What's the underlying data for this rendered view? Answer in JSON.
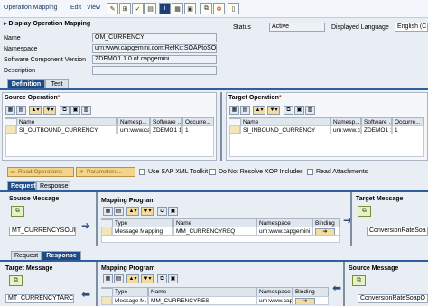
{
  "menu": {
    "operation_mapping": "Operation Mapping",
    "edit": "Edit",
    "view": "View"
  },
  "title": "Display Operation Mapping",
  "header": {
    "name_label": "Name",
    "name_value": "OM_CURRENCY",
    "namespace_label": "Namespace",
    "namespace_value": "urn:www.capgemini.com:RefKit:SOAPtoSOAP",
    "swc_label": "Software Component Version",
    "swc_value": "ZDEMO1 1.0 of capgemini",
    "description_label": "Description",
    "status_label": "Status",
    "status_value": "Active",
    "language_label": "Displayed Language",
    "language_value": "English (C"
  },
  "tabs": {
    "definition": "Definition",
    "test": "Test"
  },
  "source_operation": {
    "title": "Source Operation",
    "required_mark": "*",
    "columns": [
      "Name",
      "Namesp...",
      "Software ...",
      "Occurre..."
    ],
    "row": [
      "SI_OUTBOUND_CURRENCY",
      "urn:www.ca",
      "ZDEMO1 1.",
      "1"
    ]
  },
  "target_operation": {
    "title": "Target Operation",
    "required_mark": "*",
    "columns": [
      "Name",
      "Namesp...",
      "Software ...",
      "Occurre..."
    ],
    "row": [
      "SI_INBOUND_CURRENCY",
      "urn:www.ca",
      "ZDEMO1 1.",
      "1"
    ]
  },
  "actions": {
    "read_operations": "Read Operations",
    "parameters": "Parameters...",
    "use_sap_xml_toolkit": "Use SAP XML Toolkit",
    "do_not_resolve_xop": "Do Not Resolve XOP Includes",
    "read_attachments": "Read Attachments"
  },
  "request_tabs": {
    "request": "Request",
    "response": "Response"
  },
  "request": {
    "source_message_label": "Source Message",
    "source_message_value": "MT_CURRENCYSOUF",
    "mapping_program_label": "Mapping Program",
    "columns": [
      "Type",
      "Name",
      "Namespace",
      "Binding"
    ],
    "row": [
      "Message Mapping",
      "MM_CURRENCYREQ",
      "urn:www.capgemini",
      ""
    ],
    "target_message_label": "Target Message",
    "target_message_value": "ConversionRateSoa"
  },
  "response_tabs": {
    "request": "Request",
    "response": "Response"
  },
  "response": {
    "target_message_label": "Target Message",
    "target_message_value": "MT_CURRENCYTARC",
    "mapping_program_label": "Mapping Program",
    "columns": [
      "Type",
      "Name",
      "Namespace",
      "Binding"
    ],
    "row": [
      "Message M...",
      "MM_CURRENCYRES",
      "urn:www.capgemini",
      ""
    ],
    "source_message_label": "Source Message",
    "source_message_value": "ConversionRateSoapO"
  },
  "colors": {
    "tab_active": "#1e4b86",
    "accent_line": "#2f5f9f",
    "amber_button": "#f2d58a"
  }
}
